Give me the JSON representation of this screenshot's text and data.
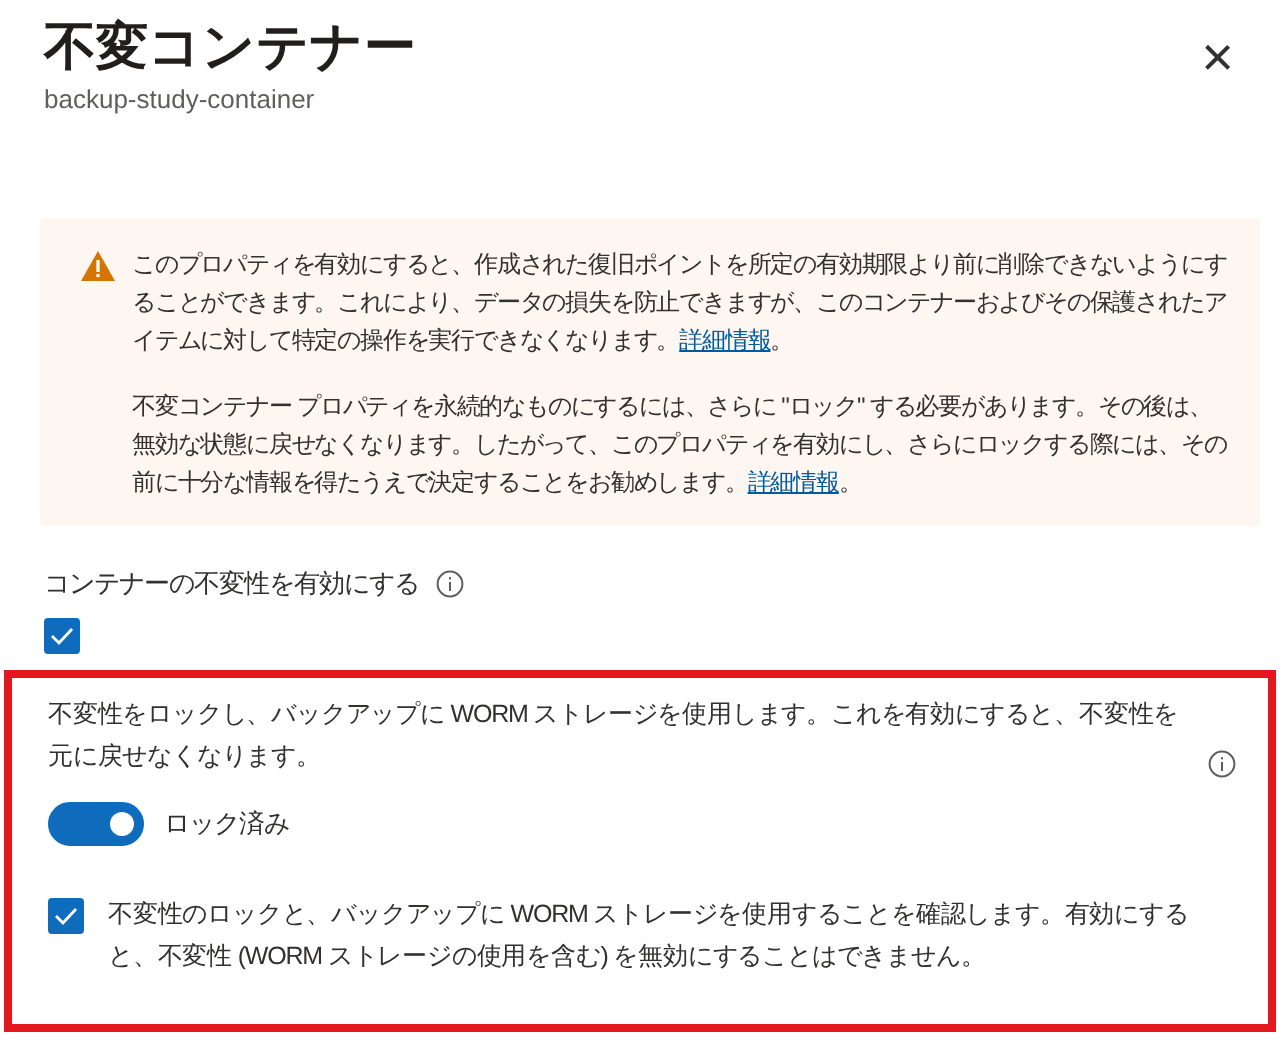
{
  "panel": {
    "title": "不変コンテナー",
    "subtitle": "backup-study-container",
    "close": "×"
  },
  "warning": {
    "paragraphs": [
      {
        "text": "このプロパティを有効にすると、作成された復旧ポイントを所定の有効期限より前に削除できないようにすることができます。これにより、データの損失を防止できますが、このコンテナーおよびその保護されたアイテムに対して特定の操作を実行できなくなります。",
        "link": "詳細情報",
        "suffix": "。"
      },
      {
        "text": "不変コンテナー プロパティを永続的なものにするには、さらに \"ロック\" する必要があります。その後は、無効な状態に戻せなくなります。したがって、このプロパティを有効にし、さらにロックする際には、その前に十分な情報を得たうえで決定することをお勧めします。",
        "link": "詳細情報",
        "suffix": "。"
      }
    ]
  },
  "enable": {
    "label": "コンテナーの不変性を有効にする",
    "checked": true
  },
  "lock_section": {
    "highlighted": true,
    "description": "不変性をロックし、バックアップに WORM ストレージを使用します。これを有効にすると、不変性を元に戻せなくなります。",
    "toggle": {
      "label": "ロック済み",
      "on": true
    },
    "confirm": {
      "label": "不変性のロックと、バックアップに WORM ストレージを使用することを確認します。有効にすると、不変性 (WORM ストレージの使用を含む) を無効にすることはできません。",
      "checked": true
    }
  }
}
